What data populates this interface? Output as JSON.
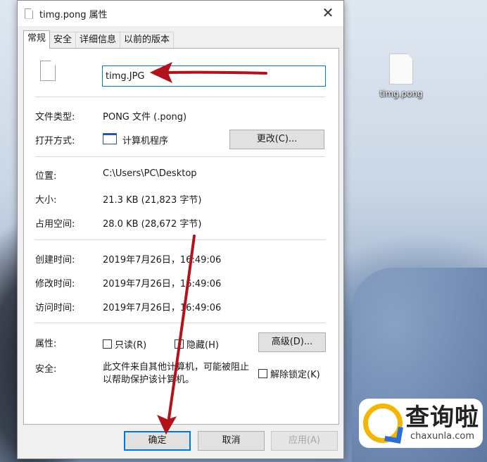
{
  "dialog": {
    "title": "timg.pong 属性",
    "close_label": "✕"
  },
  "tabs": [
    {
      "label": "常规",
      "active": true
    },
    {
      "label": "安全",
      "active": false
    },
    {
      "label": "详细信息",
      "active": false
    },
    {
      "label": "以前的版本",
      "active": false
    }
  ],
  "general": {
    "file_name_value": "timg.JPG",
    "file_type_label": "文件类型:",
    "file_type_value": "PONG 文件 (.pong)",
    "open_with_label": "打开方式:",
    "open_with_value": "计算机程序",
    "change_button": "更改(C)...",
    "location_label": "位置:",
    "location_value": "C:\\Users\\PC\\Desktop",
    "size_label": "大小:",
    "size_value": "21.3 KB (21,823 字节)",
    "disk_size_label": "占用空间:",
    "disk_size_value": "28.0 KB (28,672 字节)",
    "created_label": "创建时间:",
    "created_value": "2019年7月26日，16:49:06",
    "modified_label": "修改时间:",
    "modified_value": "2019年7月26日，16:49:06",
    "accessed_label": "访问时间:",
    "accessed_value": "2019年7月26日，16:49:06",
    "attributes_label": "属性:",
    "readonly_label": "只读(R)",
    "hidden_label": "隐藏(H)",
    "advanced_button": "高级(D)...",
    "security_label": "安全:",
    "security_text_line1": "此文件来自其他计算机，可能被阻止",
    "security_text_line2": "以帮助保护该计算机。",
    "unblock_label": "解除锁定(K)"
  },
  "footer": {
    "ok_button": "确定",
    "cancel_button": "取消",
    "apply_button": "应用(A)"
  },
  "desktop": {
    "file_label": "timg.pong"
  },
  "watermark": {
    "cn": "查询啦",
    "en": "chaxunla.com"
  },
  "colors": {
    "accent": "#0078d7",
    "annotation_arrow": "#b3121d",
    "watermark_yellow": "#f2b705",
    "watermark_blue": "#2b6fd6"
  }
}
